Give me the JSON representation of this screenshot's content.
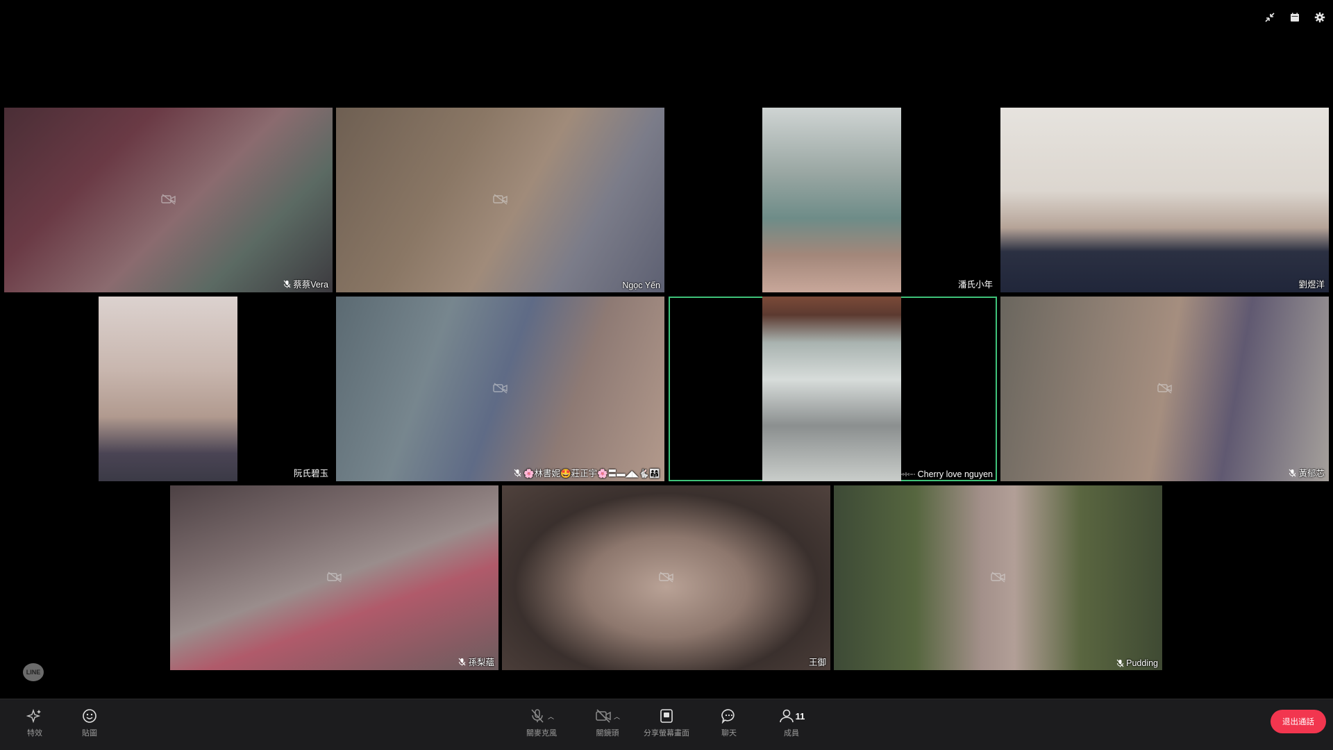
{
  "top_controls": [
    {
      "icon": "minimize-icon"
    },
    {
      "icon": "calendar-icon"
    },
    {
      "icon": "gear-icon"
    }
  ],
  "participants": [
    {
      "name": "蔡蔡Vera",
      "muted": true,
      "camera_off": true
    },
    {
      "name": "Ngọc Yến",
      "muted": false,
      "camera_off": true
    },
    {
      "name": "潘氏小年",
      "muted": false,
      "camera_off": false
    },
    {
      "name": "劉煜洋",
      "muted": false,
      "camera_off": false
    },
    {
      "name": "阮氏碧玉",
      "muted": false,
      "camera_off": false
    },
    {
      "name": "🌸林書妮🤩莊正宇🌸〓▬◢◣🐇👨‍👩‍👧",
      "muted": true,
      "camera_off": true
    },
    {
      "name": "Cherry love nguyen",
      "muted": false,
      "camera_off": false,
      "speaking": true
    },
    {
      "name": "黃郁芯",
      "muted": true,
      "camera_off": true
    },
    {
      "name": "孫梨蘊",
      "muted": true,
      "camera_off": true
    },
    {
      "name": "王御",
      "muted": false,
      "camera_off": true
    },
    {
      "name": "Pudding",
      "muted": true,
      "camera_off": true
    }
  ],
  "watermark": {
    "text": "LINE"
  },
  "toolbar": {
    "effects_label": "特效",
    "stickers_label": "貼圖",
    "mic_label": "關麥克風",
    "camera_label": "關鏡頭",
    "share_label": "分享螢幕畫面",
    "chat_label": "聊天",
    "members_label": "成員",
    "members_count": "11",
    "leave_label": "退出通話"
  },
  "colors": {
    "accent_speaking": "#3fc37a",
    "leave": "#f2364f",
    "toolbar_bg": "#1c1c1e"
  }
}
